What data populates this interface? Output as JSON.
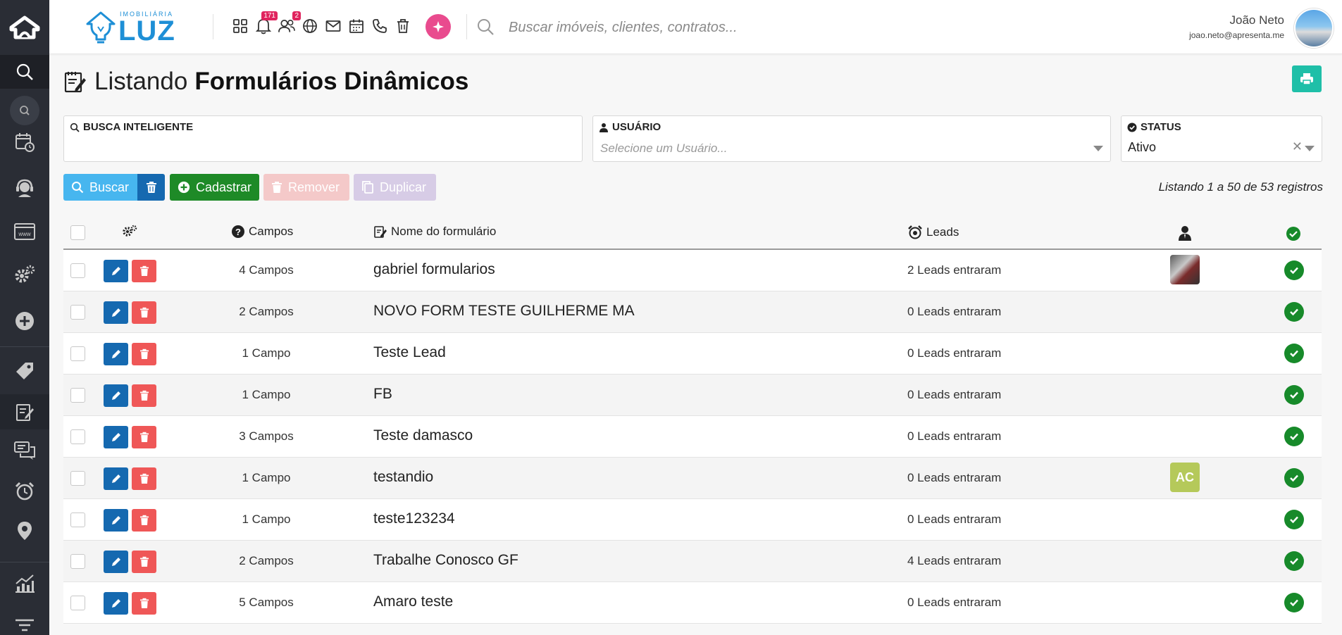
{
  "header": {
    "logo_small": "IMOBILIÁRIA",
    "logo_big": "LUZ",
    "badges": {
      "notifications": "171",
      "users": "2"
    },
    "search_placeholder": "Buscar imóveis, clientes, contratos...",
    "user_name": "João Neto",
    "user_email": "joao.neto@apresenta.me"
  },
  "page": {
    "title_light": "Listando",
    "title_bold": "Formulários Dinâmicos"
  },
  "filters": {
    "busca_label": "BUSCA INTELIGENTE",
    "usuario_label": "USUÁRIO",
    "usuario_placeholder": "Selecione um Usuário...",
    "status_label": "STATUS",
    "status_value": "Ativo"
  },
  "actions": {
    "buscar": "Buscar",
    "cadastrar": "Cadastrar",
    "remover": "Remover",
    "duplicar": "Duplicar"
  },
  "listing_info": "Listando 1 a 50 de 53 registros",
  "table": {
    "headers": {
      "campos": "Campos",
      "nome": "Nome do formulário",
      "leads": "Leads"
    },
    "rows": [
      {
        "campos": "4 Campos",
        "nome": "gabriel formularios",
        "leads": "2 Leads entraram",
        "avatar": "photo",
        "initials": ""
      },
      {
        "campos": "2 Campos",
        "nome": "NOVO FORM TESTE GUILHERME MA",
        "leads": "0 Leads entraram",
        "avatar": "",
        "initials": ""
      },
      {
        "campos": "1 Campo",
        "nome": "Teste Lead",
        "leads": "0 Leads entraram",
        "avatar": "",
        "initials": ""
      },
      {
        "campos": "1 Campo",
        "nome": "FB",
        "leads": "0 Leads entraram",
        "avatar": "",
        "initials": ""
      },
      {
        "campos": "3 Campos",
        "nome": "Teste damasco",
        "leads": "0 Leads entraram",
        "avatar": "",
        "initials": ""
      },
      {
        "campos": "1 Campo",
        "nome": "testandio",
        "leads": "0 Leads entraram",
        "avatar": "initials",
        "initials": "AC"
      },
      {
        "campos": "1 Campo",
        "nome": "teste123234",
        "leads": "0 Leads entraram",
        "avatar": "",
        "initials": ""
      },
      {
        "campos": "2 Campos",
        "nome": "Trabalhe Conosco GF",
        "leads": "4 Leads entraram",
        "avatar": "",
        "initials": ""
      },
      {
        "campos": "5 Campos",
        "nome": "Amaro teste",
        "leads": "0 Leads entraram",
        "avatar": "",
        "initials": ""
      }
    ]
  },
  "colors": {
    "sidebar": "#2a2d35",
    "brand": "#1e8fd6",
    "primary": "#1569b0",
    "danger": "#ef5757",
    "success": "#178a2a",
    "teal": "#1fbfa8"
  }
}
